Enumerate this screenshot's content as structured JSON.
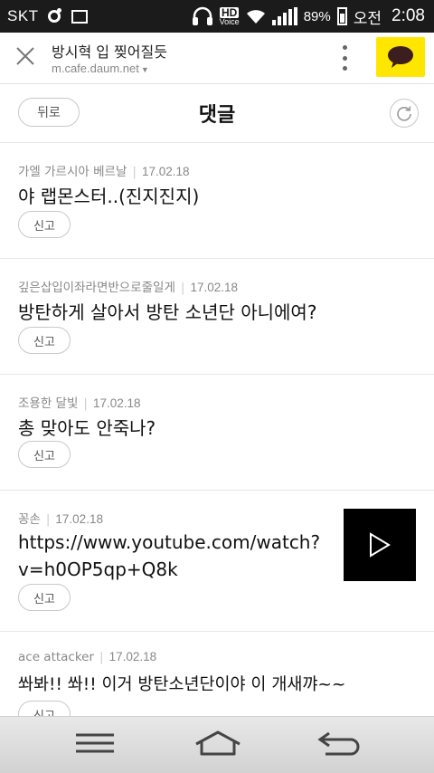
{
  "status_bar": {
    "carrier": "SKT",
    "hd": "HD",
    "voice": "Voice",
    "battery": "89%",
    "ampm": "오전",
    "time": "2:08"
  },
  "browser": {
    "page_title": "방시혁 입 찢어질듯",
    "url": "m.cafe.daum.net",
    "icons": [
      "close-icon",
      "more-vert-icon",
      "kakaotalk-icon"
    ],
    "kakao_color": "#ffe600"
  },
  "header": {
    "back_label": "뒤로",
    "title": "댓글"
  },
  "comments": [
    {
      "author": "가엘 가르시아 베르날",
      "date": "17.02.18",
      "lines": [
        "야 랩몬스터..(진지진지)"
      ],
      "report": "신고"
    },
    {
      "author": "깊은삽입이좌라면반으로줄일게",
      "date": "17.02.18",
      "lines": [
        "방탄하게 살아서 방탄 소년단 아니에여?"
      ],
      "report": "신고"
    },
    {
      "author": "조용한 달빛",
      "date": "17.02.18",
      "lines": [
        "총 맞아도 안죽나?"
      ],
      "report": "신고"
    },
    {
      "author": "꽁손",
      "date": "17.02.18",
      "lines": [
        "https://www.youtube.com/watch?",
        "v=h0OP5qp+Q8k"
      ],
      "report": "신고",
      "has_video": true
    },
    {
      "author": "ace attacker",
      "date": "17.02.18",
      "lines": [
        "쏴봐!! 쏴!! 이거 방탄소년단이야 이 개새꺄~~"
      ],
      "report": "신고"
    }
  ]
}
